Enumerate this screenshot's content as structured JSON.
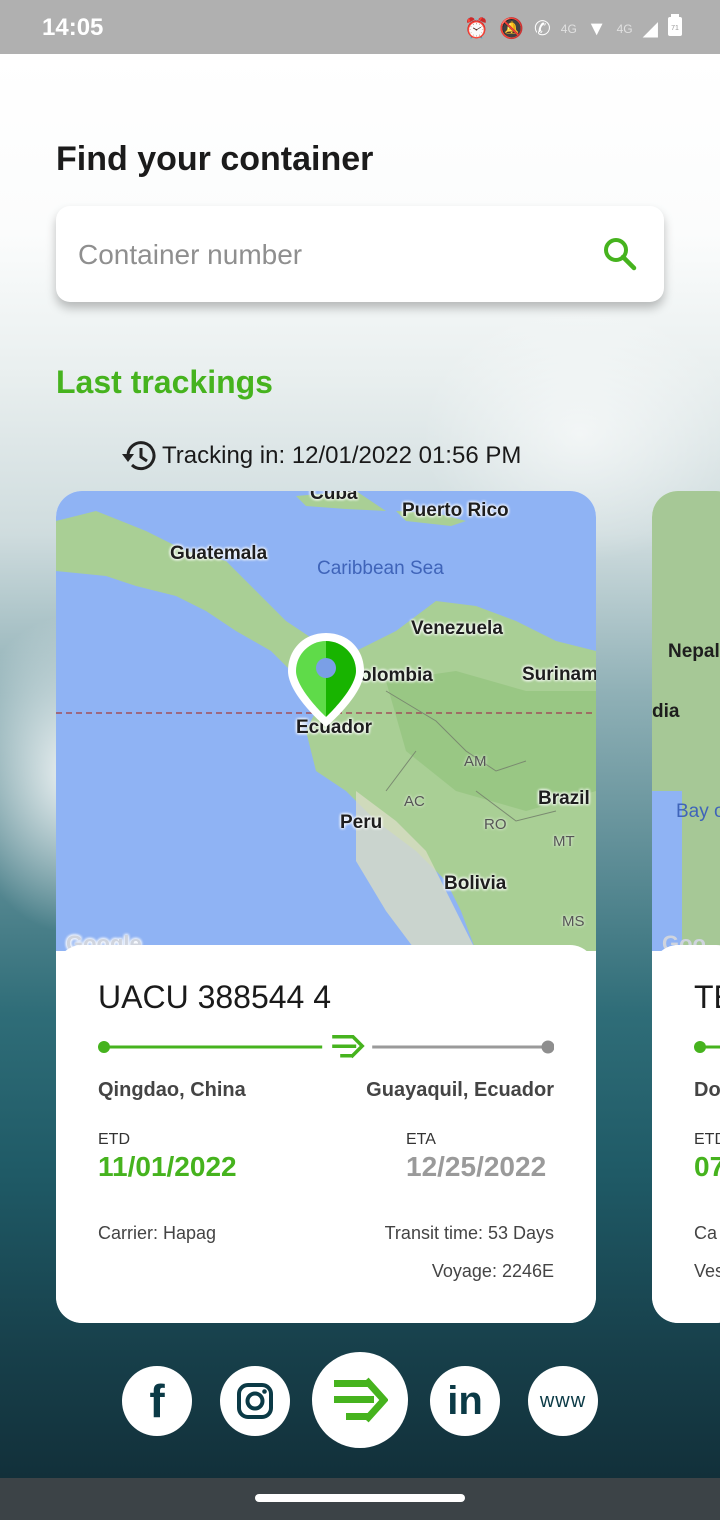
{
  "status_bar": {
    "time": "14:05",
    "icons": [
      "alarm-icon",
      "mute-icon",
      "volte-icon",
      "wifi-icon",
      "signal-icon",
      "battery-icon"
    ],
    "network_labels": [
      "4G",
      "4G"
    ],
    "battery_level": "71"
  },
  "header": {
    "title": "Find your container"
  },
  "search": {
    "placeholder": "Container number",
    "icon": "search-icon"
  },
  "last_trackings": {
    "title": "Last trackings",
    "tracking_in_label": "Tracking in: 12/01/2022 01:56 PM"
  },
  "card": {
    "map_labels": {
      "cuba": "Cuba",
      "puerto_rico": "Puerto Rico",
      "guatemala": "Guatemala",
      "caribbean_sea": "Caribbean Sea",
      "venezuela": "Venezuela",
      "colombia": "olombia",
      "surinam": "Surinam",
      "ecuador": "Ecuador",
      "am": "AM",
      "ac": "AC",
      "brazil": "Brazil",
      "peru": "Peru",
      "ro": "RO",
      "mt": "MT",
      "bolivia": "Bolivia",
      "ms": "MS",
      "google": "Google"
    },
    "container_id": "UACU 388544 4",
    "origin": "Qingdao, China",
    "destination": "Guayaquil, Ecuador",
    "etd_label": "ETD",
    "etd": "11/01/2022",
    "eta_label": "ETA",
    "eta": "12/25/2022",
    "carrier": "Carrier: Hapag",
    "transit_time": "Transit time: 53 Days",
    "voyage": "Voyage: 2246E",
    "progress_fraction": 0.55,
    "colors": {
      "accent": "#46b31e",
      "muted": "#9a9a9a"
    }
  },
  "peek_card": {
    "map_labels": {
      "nepal": "Nepal",
      "dia": "dia",
      "bay": "Bay o",
      "google": "Goo"
    },
    "container_id_partial": "TE",
    "origin_partial": "Do",
    "etd_label_partial": "ETD",
    "etd_partial": "07",
    "carrier_partial": "Ca",
    "voyage_partial": "Ves"
  },
  "social": {
    "facebook": "f",
    "linkedin": "in",
    "www": "www"
  }
}
